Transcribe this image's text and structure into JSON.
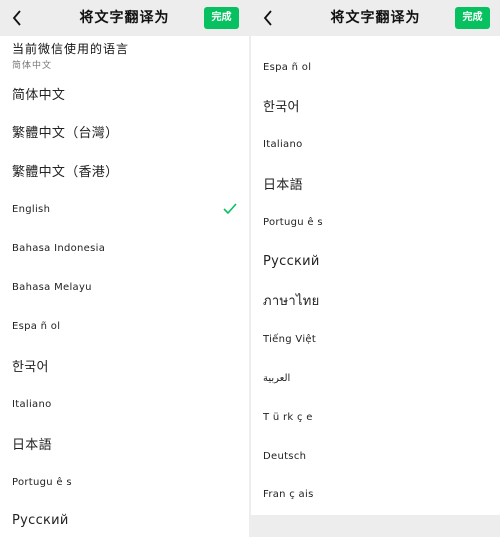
{
  "header": {
    "title": "将文字翻译为",
    "done_label": "完成"
  },
  "current_language": {
    "title": "当前微信使用的语言",
    "value": "简体中文"
  },
  "languages_left": [
    {
      "label": "简体中文",
      "big": true
    },
    {
      "label": "繁體中文（台灣）",
      "big": true
    },
    {
      "label": "繁體中文（香港）",
      "big": true
    },
    {
      "label": "English",
      "big": false,
      "selected": true
    },
    {
      "label": "Bahasa Indonesia",
      "big": false
    },
    {
      "label": "Bahasa Melayu",
      "big": false
    },
    {
      "label": "Espa ñ ol",
      "big": false
    },
    {
      "label": "한국어",
      "big": true
    },
    {
      "label": "Italiano",
      "big": false
    },
    {
      "label": "日本語",
      "big": true
    },
    {
      "label": "Portugu ê s",
      "big": false
    },
    {
      "label": "Русский",
      "big": true
    }
  ],
  "languages_right": [
    {
      "label": "Espa ñ ol",
      "big": false
    },
    {
      "label": "한국어",
      "big": true
    },
    {
      "label": "Italiano",
      "big": false
    },
    {
      "label": "日本語",
      "big": true
    },
    {
      "label": "Portugu ê s",
      "big": false
    },
    {
      "label": "Русский",
      "big": true
    },
    {
      "label": "ภาษาไทย",
      "big": true
    },
    {
      "label": "Tiếng Việt",
      "big": false
    },
    {
      "label": "العربية",
      "big": false
    },
    {
      "label": "T ü rk ç e",
      "big": false
    },
    {
      "label": "Deutsch",
      "big": false
    },
    {
      "label": "Fran ç ais",
      "big": false
    }
  ],
  "colors": {
    "accent": "#07c160",
    "nav_bg": "#ededed"
  }
}
